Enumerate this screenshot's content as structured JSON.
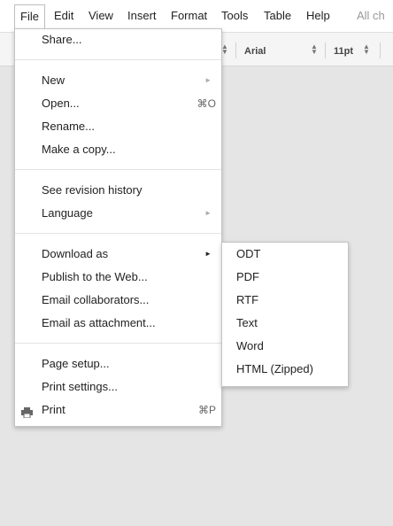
{
  "menubar": {
    "items": [
      {
        "label": "File"
      },
      {
        "label": "Edit"
      },
      {
        "label": "View"
      },
      {
        "label": "Insert"
      },
      {
        "label": "Format"
      },
      {
        "label": "Tools"
      },
      {
        "label": "Table"
      },
      {
        "label": "Help"
      }
    ],
    "save_status": "All ch"
  },
  "toolbar": {
    "font_name": "Arial",
    "font_size": "11pt"
  },
  "file_menu": {
    "share": "Share...",
    "new": "New",
    "open": "Open...",
    "open_shortcut": "⌘O",
    "rename": "Rename...",
    "make_copy": "Make a copy...",
    "revision_history": "See revision history",
    "language": "Language",
    "download_as": "Download as",
    "publish": "Publish to the Web...",
    "email_collaborators": "Email collaborators...",
    "email_attachment": "Email as attachment...",
    "page_setup": "Page setup...",
    "print_settings": "Print settings...",
    "print": "Print",
    "print_shortcut": "⌘P",
    "submenu_arrow": "►"
  },
  "download_submenu": {
    "items": [
      {
        "label": "ODT"
      },
      {
        "label": "PDF"
      },
      {
        "label": "RTF"
      },
      {
        "label": "Text"
      },
      {
        "label": "Word"
      },
      {
        "label": "HTML (Zipped)"
      }
    ]
  }
}
